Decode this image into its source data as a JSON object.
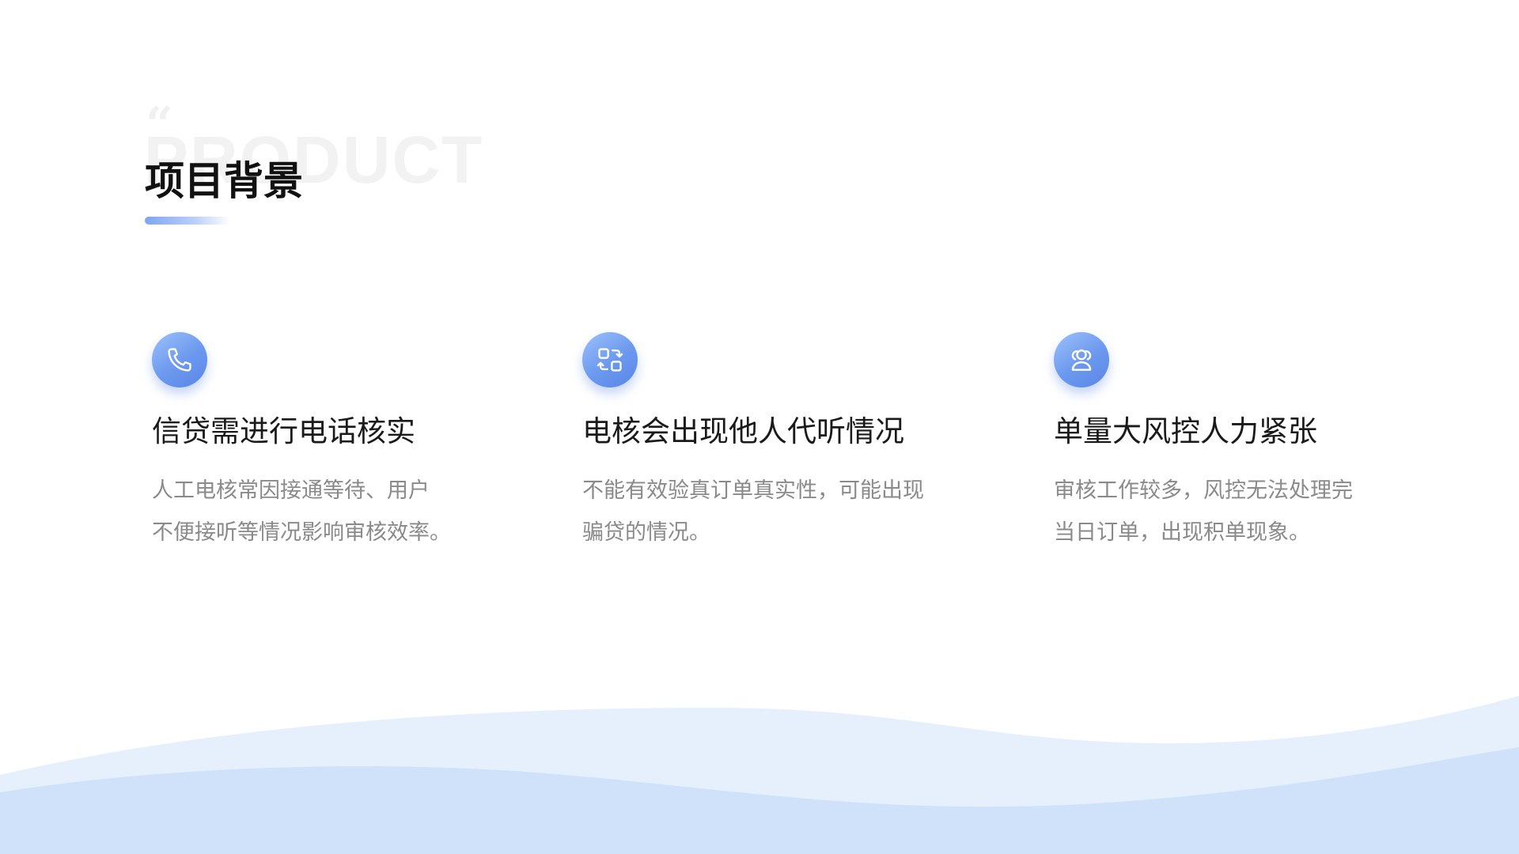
{
  "header": {
    "quote_mark": "“",
    "watermark": "PRODUCT",
    "title": "项目背景"
  },
  "cards": [
    {
      "icon": "phone-icon",
      "title": "信贷需进行电话核实",
      "desc_lines": [
        "人工电核常因接通等待、用户",
        "不便接听等情况影响审核效率。"
      ]
    },
    {
      "icon": "swap-icon",
      "title": "电核会出现他人代听情况",
      "desc_lines": [
        "不能有效验真订单真实性，可能出现",
        "骗贷的情况。"
      ]
    },
    {
      "icon": "users-icon",
      "title": "单量大风控人力紧张",
      "desc_lines": [
        "审核工作较多，风控无法处理完",
        "当日订单，出现积单现象。"
      ]
    }
  ],
  "colors": {
    "accent": "#6b98ee",
    "wave_light": "#e6f0fd",
    "wave_dark": "#cfe2fa"
  }
}
